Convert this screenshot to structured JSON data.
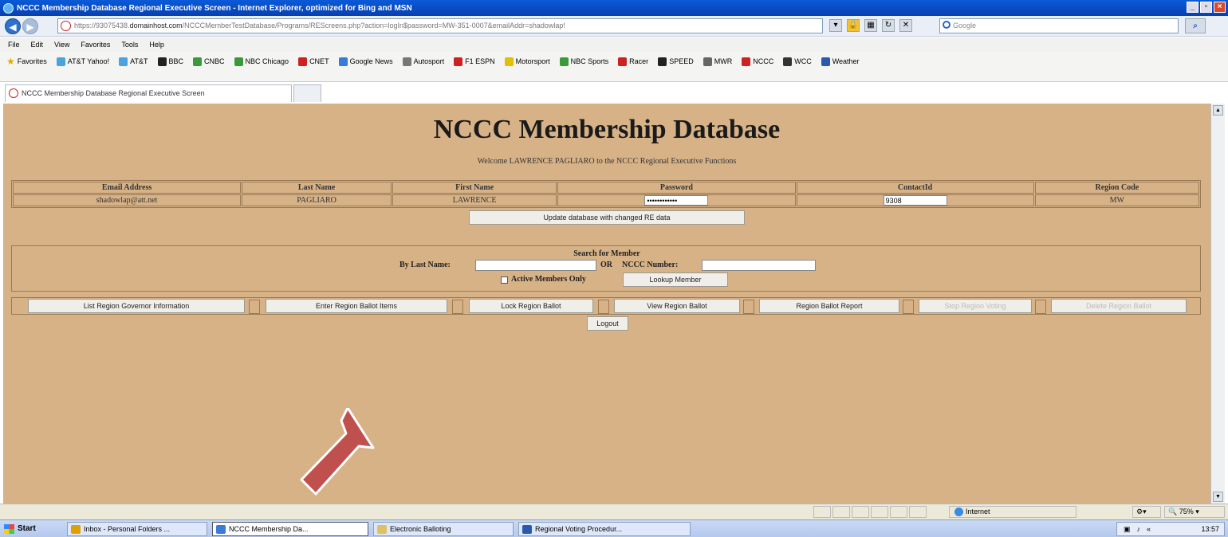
{
  "window": {
    "title": "NCCC Membership Database Regional Executive Screen - Internet Explorer, optimized for Bing and MSN"
  },
  "address": {
    "prefix": "https://",
    "host_start": "93075438.",
    "host_bold": "domainhost.com",
    "path": "/NCCCMemberTestDatabase/Programs/REScreens.php?action=logIn$password=MW-351-0007&emailAddr=shadowlap!",
    "search_placeholder": "Google"
  },
  "menu": [
    "File",
    "Edit",
    "View",
    "Favorites",
    "Tools",
    "Help"
  ],
  "favorites": {
    "label": "Favorites",
    "items": [
      {
        "label": "AT&T Yahoo!",
        "color": "#4aa3df"
      },
      {
        "label": "AT&T",
        "color": "#4aa3df"
      },
      {
        "label": "BBC",
        "color": "#222222"
      },
      {
        "label": "CNBC",
        "color": "#3a9a3a"
      },
      {
        "label": "NBC Chicago",
        "color": "#3a9a3a"
      },
      {
        "label": "CNET",
        "color": "#cc2222"
      },
      {
        "label": "Google News",
        "color": "#3a7ad8"
      },
      {
        "label": "Autosport",
        "color": "#777777"
      },
      {
        "label": "F1 ESPN",
        "color": "#cc2222"
      },
      {
        "label": "Motorsport",
        "color": "#e0c000"
      },
      {
        "label": "NBC Sports",
        "color": "#3a9a3a"
      },
      {
        "label": "Racer",
        "color": "#cc2222"
      },
      {
        "label": "SPEED",
        "color": "#222222"
      },
      {
        "label": "MWR",
        "color": "#666666"
      },
      {
        "label": "NCCC",
        "color": "#cc2222"
      },
      {
        "label": "WCC",
        "color": "#333333"
      },
      {
        "label": "Weather",
        "color": "#2a5ab0"
      }
    ]
  },
  "tab": {
    "label": "NCCC Membership Database Regional Executive Screen"
  },
  "page": {
    "title": "NCCC Membership Database",
    "welcome": "Welcome LAWRENCE PAGLIARO to the NCCC Regional Executive Functions",
    "headers": [
      "Email Address",
      "Last Name",
      "First Name",
      "Password",
      "ContactId",
      "Region Code"
    ],
    "row": {
      "email": "shadowlap@att.net",
      "last_name": "PAGLIARO",
      "first_name": "LAWRENCE",
      "password": "••••••••••••",
      "contact_id": "9308",
      "region_code": "MW"
    },
    "update_button": "Update database with changed RE data",
    "search": {
      "title": "Search for Member",
      "by_last_name": "By Last Name:",
      "or": "OR",
      "nccc_number": "NCCC Number:",
      "active_only": "Active Members Only",
      "lookup_button": "Lookup Member"
    },
    "actions": [
      {
        "label": "List Region Governor Information",
        "enabled": true
      },
      {
        "label": "Enter Region Ballot Items",
        "enabled": true
      },
      {
        "label": "Lock Region Ballot",
        "enabled": true
      },
      {
        "label": "View Region Ballot",
        "enabled": true
      },
      {
        "label": "Region Ballot Report",
        "enabled": true
      },
      {
        "label": "Stop Region Voting",
        "enabled": false
      },
      {
        "label": "Delete Region Ballot",
        "enabled": false
      }
    ],
    "logout_button": "Logout"
  },
  "status": {
    "zone": "Internet",
    "zoom": "75%"
  },
  "taskbar": {
    "start": "Start",
    "tasks": [
      {
        "label": "Inbox - Personal Folders ...",
        "color": "#e0a000"
      },
      {
        "label": "NCCC Membership Da...",
        "color": "#3a7ad8"
      },
      {
        "label": "Electronic Balloting",
        "color": "#e0c060"
      },
      {
        "label": "Regional Voting Procedur...",
        "color": "#2a5ab0"
      }
    ],
    "clock": "13:57"
  },
  "annotation": {
    "arrow_color": "#c0504d"
  }
}
